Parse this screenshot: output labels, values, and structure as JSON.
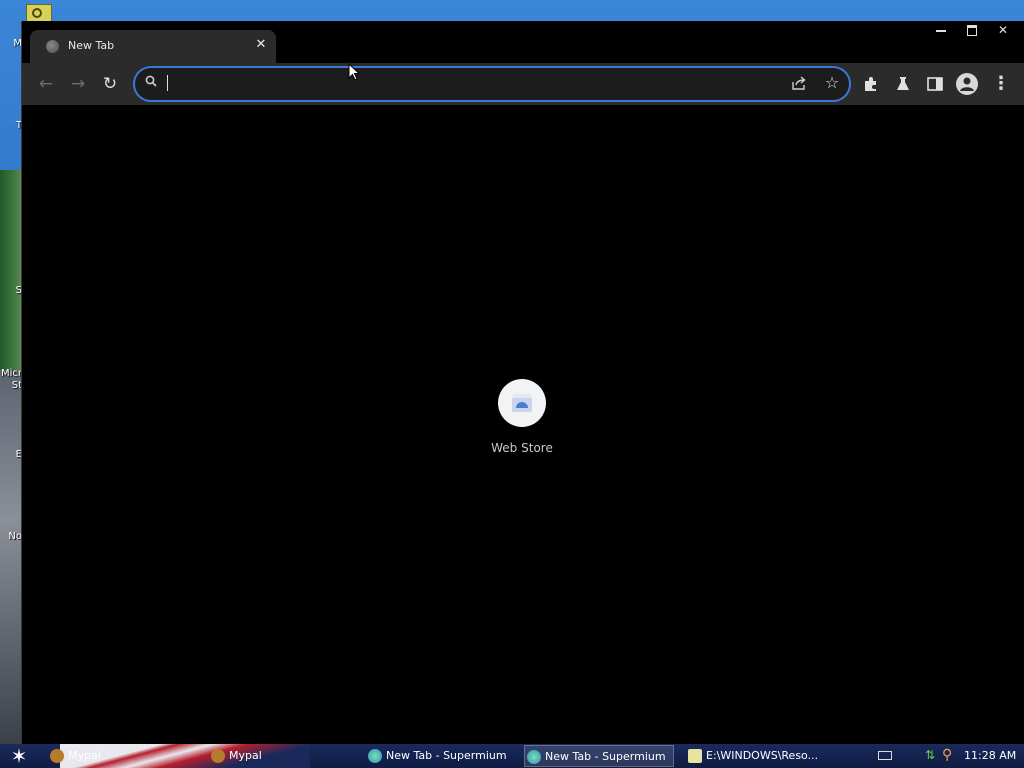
{
  "desktop": {
    "labels": [
      "M",
      "T",
      "S",
      "Micr",
      "St",
      "E",
      "No"
    ]
  },
  "browser": {
    "tab": {
      "title": "New Tab"
    },
    "window_controls": {
      "minimize": "minimize",
      "maximize": "maximize",
      "close": "✕"
    },
    "toolbar": {
      "back": "←",
      "forward": "→",
      "reload": "↻",
      "omnibox": {
        "value": "",
        "placeholder": ""
      },
      "star": "☆",
      "menu": "⋮"
    },
    "shortcuts": [
      {
        "label": "Web Store",
        "icon": "web-store-icon"
      }
    ]
  },
  "taskbar": {
    "start": "✶",
    "items": [
      {
        "label": "Mypal",
        "icon": "mypal-icon"
      },
      {
        "label": "Mypal",
        "icon": "mypal-icon"
      },
      {
        "label": "New Tab - Supermium",
        "icon": "supermium-icon"
      },
      {
        "label": "New Tab - Supermium",
        "icon": "supermium-icon",
        "active": true
      },
      {
        "label": "E:\\WINDOWS\\Reso...",
        "icon": "notepad-icon"
      }
    ],
    "clock": "11:28 AM"
  },
  "colors": {
    "accent": "#3c78d8",
    "toolbar_bg": "#2b2b2b",
    "content_bg": "#000000"
  }
}
